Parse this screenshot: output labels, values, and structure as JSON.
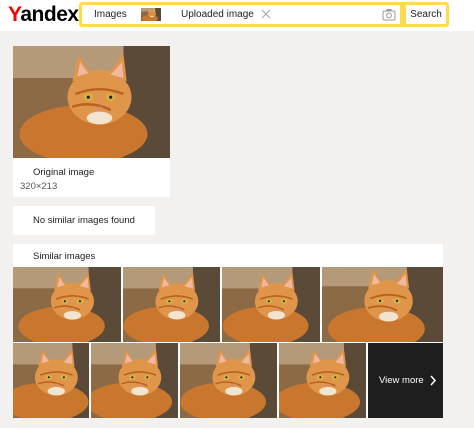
{
  "header": {
    "logo_first": "Y",
    "logo_rest": "andex",
    "tab_images": "Images",
    "uploaded_label": "Uploaded image",
    "search_button": "Search"
  },
  "original": {
    "label": "Original image",
    "size": "320×213"
  },
  "no_similar": {
    "text": "No similar images found"
  },
  "similar": {
    "title": "Similar images",
    "view_more": "View more"
  },
  "colors": {
    "brand_red": "#ff0000",
    "search_yellow": "#ffdb4d",
    "page_bg": "#f2f1ef",
    "cat_orange": "#d98a3e"
  },
  "icons": [
    "clear-icon",
    "camera-icon",
    "chevron-right-icon"
  ]
}
